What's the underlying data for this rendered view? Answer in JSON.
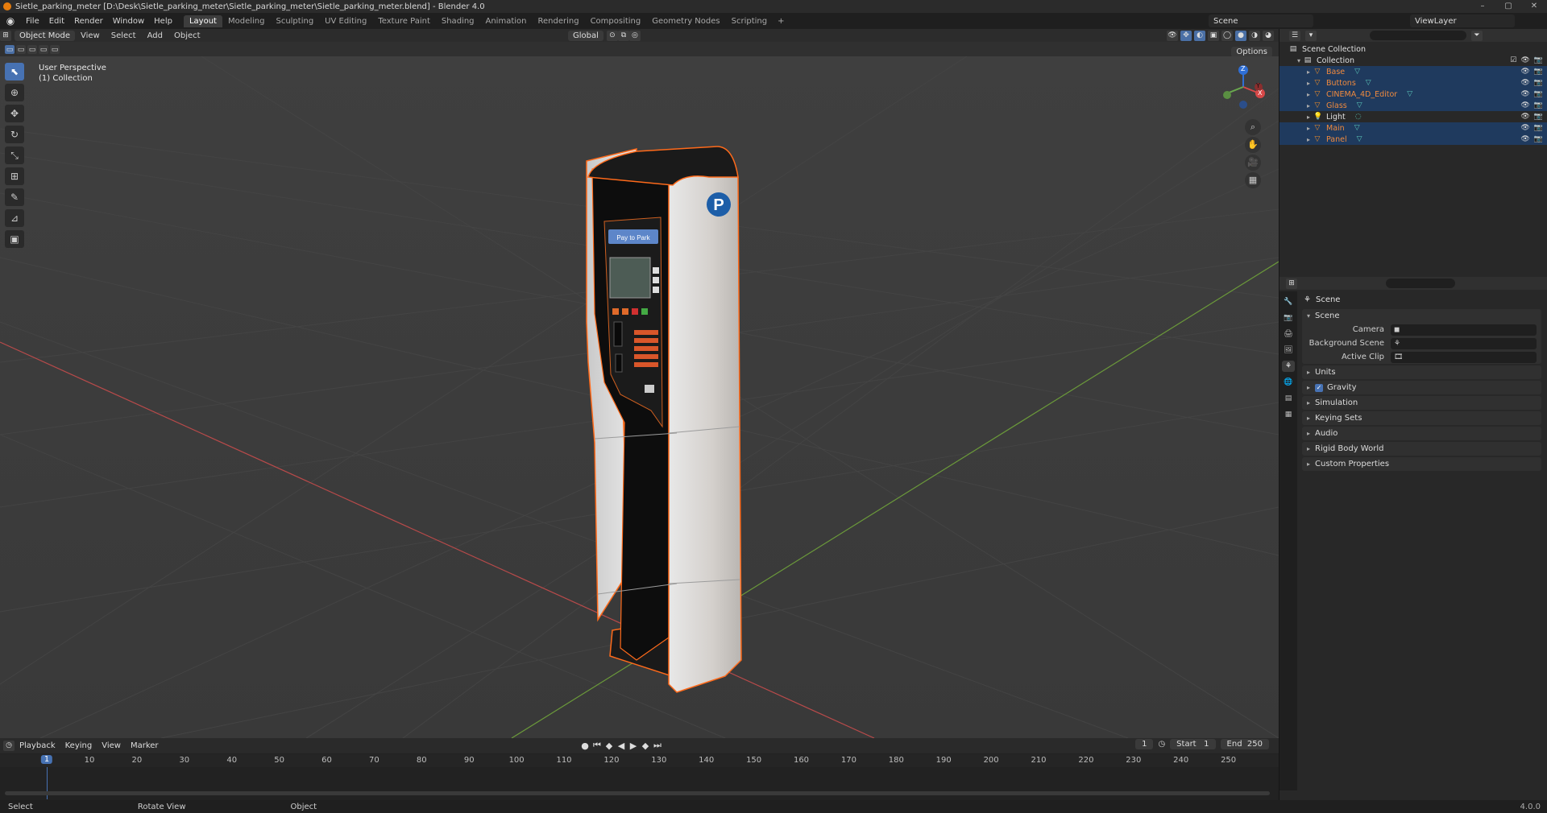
{
  "window": {
    "title": "Sietle_parking_meter [D:\\Desk\\Sietle_parking_meter\\Sietle_parking_meter\\Sietle_parking_meter.blend] - Blender 4.0"
  },
  "menu": {
    "items": [
      "File",
      "Edit",
      "Render",
      "Window",
      "Help"
    ]
  },
  "workspaces": {
    "tabs": [
      "Layout",
      "Modeling",
      "Sculpting",
      "UV Editing",
      "Texture Paint",
      "Shading",
      "Animation",
      "Rendering",
      "Compositing",
      "Geometry Nodes",
      "Scripting"
    ],
    "active": "Layout",
    "plus": "+"
  },
  "scene_selector": {
    "label": "Scene"
  },
  "viewlayer_selector": {
    "label": "ViewLayer"
  },
  "viewport_header": {
    "mode": "Object Mode",
    "menus": [
      "View",
      "Select",
      "Add",
      "Object"
    ],
    "orientation": "Global",
    "options_label": "Options"
  },
  "viewport": {
    "perspective": "User Perspective",
    "collection": "(1) Collection"
  },
  "model": {
    "sign_letter": "P",
    "panel_banner": "Pay to Park"
  },
  "gizmo": {
    "z": "Z",
    "y": "Y",
    "x": "X"
  },
  "outliner": {
    "root": "Scene Collection",
    "collection": "Collection",
    "objects": [
      {
        "name": "Base",
        "selected": true
      },
      {
        "name": "Buttons",
        "selected": true
      },
      {
        "name": "CINEMA_4D_Editor",
        "selected": true
      },
      {
        "name": "Glass",
        "selected": true
      },
      {
        "name": "Light",
        "selected": false
      },
      {
        "name": "Main",
        "selected": true
      },
      {
        "name": "Panel",
        "selected": true
      }
    ]
  },
  "properties": {
    "context": "Scene",
    "section": "Scene",
    "fields": [
      {
        "label": "Camera"
      },
      {
        "label": "Background Scene"
      },
      {
        "label": "Active Clip"
      }
    ],
    "panels": [
      "Units",
      "Gravity",
      "Simulation",
      "Keying Sets",
      "Audio",
      "Rigid Body World",
      "Custom Properties"
    ],
    "gravity_checked": true
  },
  "timeline": {
    "menus": [
      "Playback",
      "Keying",
      "View",
      "Marker"
    ],
    "current_frame": "1",
    "start_label": "Start",
    "start": "1",
    "end_label": "End",
    "end": "250",
    "ticks": [
      "10",
      "20",
      "30",
      "40",
      "50",
      "60",
      "70",
      "80",
      "90",
      "100",
      "110",
      "120",
      "130",
      "140",
      "150",
      "160",
      "170",
      "180",
      "190",
      "200",
      "210",
      "220",
      "230",
      "240",
      "250"
    ]
  },
  "statusbar": {
    "select": "Select",
    "rotate": "Rotate View",
    "object": "Object",
    "version": "4.0.0"
  },
  "colors": {
    "selection_orange": "#f08a3e",
    "accent_blue": "#4772b3",
    "viewport_bg": "#3c3c3c"
  }
}
